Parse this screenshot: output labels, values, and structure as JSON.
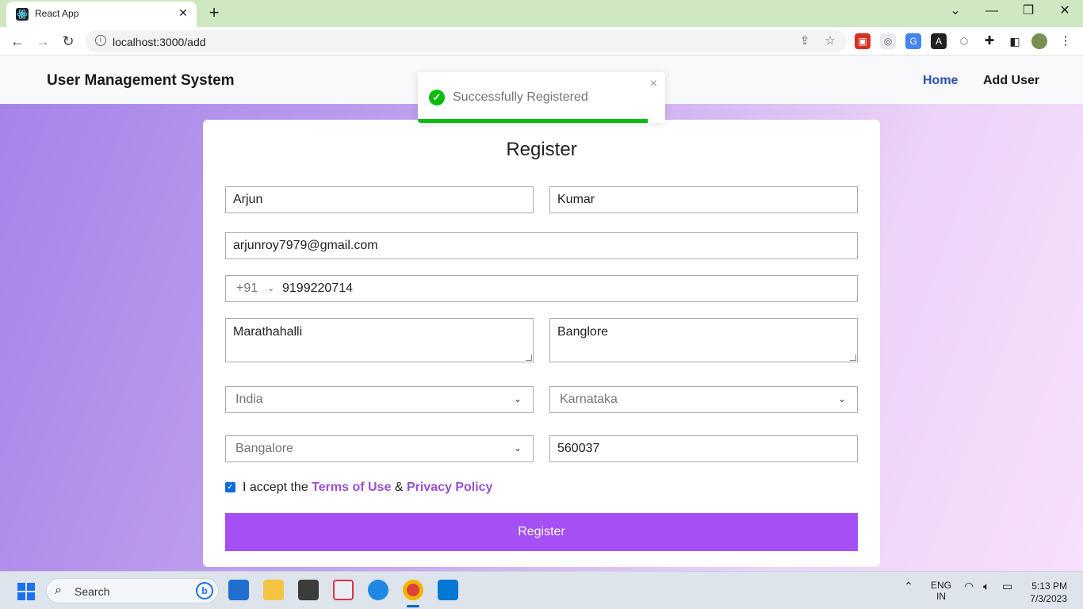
{
  "browser": {
    "tab_title": "React App",
    "url": "localhost:3000/add"
  },
  "app": {
    "brand": "User Management System",
    "nav": {
      "home": "Home",
      "add_user": "Add User"
    }
  },
  "toast": {
    "message": "Successfully Registered",
    "close": "×",
    "progress": 0.93
  },
  "form": {
    "title": "Register",
    "first_name": "Arjun",
    "last_name": "Kumar",
    "email": "arjunroy7979@gmail.com",
    "phone_code": "+91",
    "phone": "9199220714",
    "address": "Marathahalli",
    "address2": "Banglore",
    "country": "India",
    "state": "Karnataka",
    "city": "Bangalore",
    "pincode": "560037",
    "terms_prefix": "I accept the",
    "terms_link": "Terms of Use",
    "terms_amp": "&",
    "privacy_link": "Privacy Policy",
    "submit": "Register"
  },
  "taskbar": {
    "search": "Search",
    "lang_top": "ENG",
    "lang_bottom": "IN",
    "time": "5:13 PM",
    "date": "7/3/2023"
  }
}
